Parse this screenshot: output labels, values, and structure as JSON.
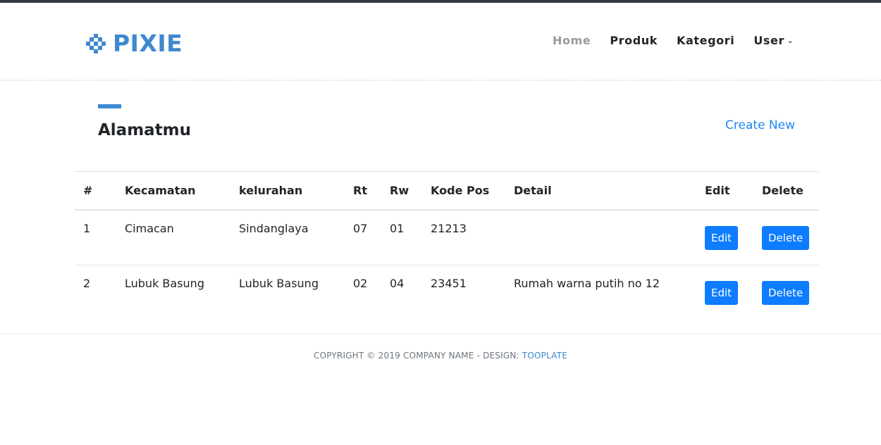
{
  "brand": {
    "name": "PIXIE"
  },
  "nav": {
    "items": [
      {
        "label": "Home",
        "active": true
      },
      {
        "label": "Produk",
        "active": false
      },
      {
        "label": "Kategori",
        "active": false
      },
      {
        "label": "User",
        "active": false,
        "dropdown": true
      }
    ]
  },
  "page": {
    "title": "Alamatmu",
    "create_label": "Create New"
  },
  "table": {
    "headers": [
      "#",
      "Kecamatan",
      "kelurahan",
      "Rt",
      "Rw",
      "Kode Pos",
      "Detail",
      "Edit",
      "Delete"
    ],
    "rows": [
      {
        "no": "1",
        "kecamatan": "Cimacan",
        "kelurahan": "Sindanglaya",
        "rt": "07",
        "rw": "01",
        "kode_pos": "21213",
        "detail": "",
        "edit_label": "Edit",
        "delete_label": "Delete"
      },
      {
        "no": "2",
        "kecamatan": "Lubuk Basung",
        "kelurahan": "Lubuk Basung",
        "rt": "02",
        "rw": "04",
        "kode_pos": "23451",
        "detail": "Rumah warna putih no 12",
        "edit_label": "Edit",
        "delete_label": "Delete"
      }
    ]
  },
  "footer": {
    "text": "COPYRIGHT © 2019 COMPANY NAME - DESIGN: ",
    "link": "TOOPLATE"
  },
  "colors": {
    "brand": "#3f88d0",
    "button": "#0d7cff",
    "link": "#1e88f0",
    "nav_active": "#9a9a9a"
  },
  "icons": {
    "logo": "pixel-diamond-icon",
    "dropdown": "chevron-down-icon"
  }
}
